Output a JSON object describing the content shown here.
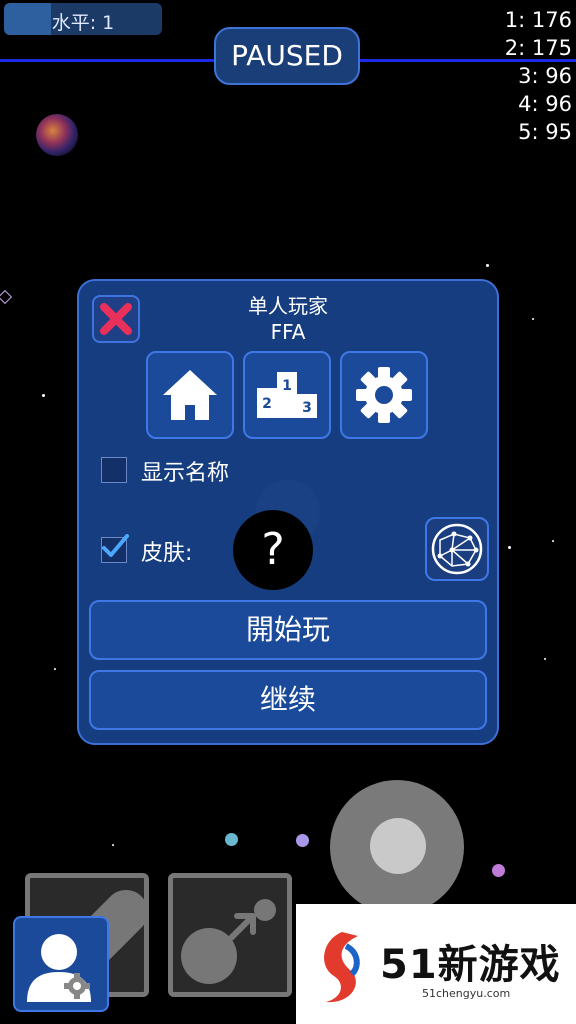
{
  "level": {
    "label": "水平: 1",
    "progress": 0.3
  },
  "status": {
    "paused_label": "PAUSED"
  },
  "leaderboard": [
    "1: 176",
    "2: 175",
    "3: 96",
    "4: 96",
    "5: 95"
  ],
  "dialog": {
    "mode_line1": "单人玩家",
    "mode_line2": "FFA",
    "icons": [
      "home-icon",
      "podium-icon",
      "gear-icon"
    ],
    "show_names": {
      "label": "显示名称",
      "checked": false
    },
    "skin": {
      "label": "皮肤:",
      "checked": true,
      "placeholder": "?"
    },
    "play_label": "開始玩",
    "continue_label": "继续"
  },
  "podium_numbers": [
    "1",
    "2",
    "3"
  ],
  "watermark": {
    "brand": "51新游戏",
    "url": "51chengyu.com"
  },
  "colors": {
    "panel": "#18428a",
    "accent": "#3f78e6",
    "close": "#e8305a",
    "check": "#4aa8ff"
  }
}
